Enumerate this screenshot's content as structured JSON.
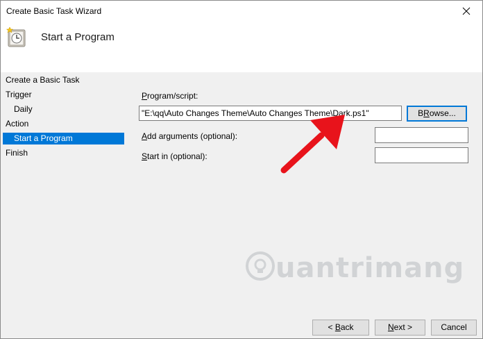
{
  "window": {
    "title": "Create Basic Task Wizard",
    "close_glyph": "✕"
  },
  "header": {
    "title": "Start a Program",
    "icon": "task-scheduler-clock-icon"
  },
  "nav": {
    "items": [
      {
        "label": "Create a Basic Task",
        "level": "top",
        "selected": false
      },
      {
        "label": "Trigger",
        "level": "top",
        "selected": false
      },
      {
        "label": "Daily",
        "level": "sub",
        "selected": false
      },
      {
        "label": "Action",
        "level": "top",
        "selected": false
      },
      {
        "label": "Start a Program",
        "level": "sub",
        "selected": true
      },
      {
        "label": "Finish",
        "level": "top",
        "selected": false
      }
    ]
  },
  "form": {
    "program_label_u": "P",
    "program_label_rest": "rogram/script:",
    "program_value": "\"E:\\qq\\Auto Changes Theme\\Auto Changes Theme\\Dark.ps1\"",
    "browse_label_u": "R",
    "browse_label_pre": "B",
    "browse_label_rest": "owse...",
    "args_label_u": "A",
    "args_label_rest": "dd arguments (optional):",
    "args_value": "",
    "startin_label_u": "S",
    "startin_label_rest": "tart in (optional):",
    "startin_value": ""
  },
  "footer": {
    "back_pre": "< ",
    "back_u": "B",
    "back_rest": "ack",
    "next_u": "N",
    "next_rest": "ext >",
    "cancel_label": "Cancel"
  },
  "watermark": {
    "text": "uantrimang"
  },
  "colors": {
    "selection": "#0078d7",
    "arrow": "#e8131b",
    "body_bg": "#f0f0f0"
  }
}
